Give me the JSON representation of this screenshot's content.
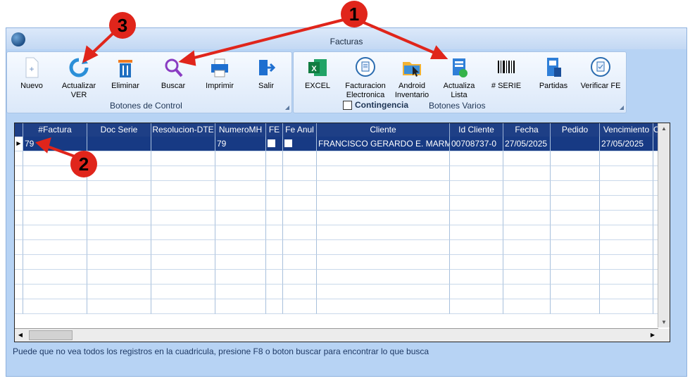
{
  "window": {
    "title": "Facturas"
  },
  "control_group": {
    "label": "Botones de Control",
    "buttons": [
      {
        "label": "Nuevo"
      },
      {
        "label": "Actualizar VER"
      },
      {
        "label": "Eliminar"
      },
      {
        "label": "Buscar"
      },
      {
        "label": "Imprimir"
      },
      {
        "label": "Salir"
      }
    ]
  },
  "varios_group": {
    "label": "Botones Varios",
    "contingencia_label": "Contingencia",
    "buttons": [
      {
        "label": "EXCEL"
      },
      {
        "label": "Facturacion Electronica"
      },
      {
        "label": "Android Inventario"
      },
      {
        "label": "Actualiza Lista"
      },
      {
        "label": "# SERIE"
      },
      {
        "label": "Partidas"
      },
      {
        "label": "Verificar FE"
      }
    ]
  },
  "grid": {
    "columns": [
      "#Factura",
      "Doc Serie",
      "Resolucion-DTE",
      "NumeroMH",
      "FE",
      "Fe Anul",
      "Cliente",
      "Id Cliente",
      "Fecha",
      "Pedido",
      "Vencimiento",
      "O"
    ],
    "rows": [
      [
        "79",
        "",
        "",
        "79",
        "",
        "",
        "FRANCISCO GERARDO E. MARM",
        "00708737-0",
        "27/05/2025",
        "",
        "27/05/2025",
        ""
      ]
    ]
  },
  "footer": {
    "message": "Puede que no vea todos los registros en la cuadricula, presione F8 o boton buscar para encontrar lo que busca"
  },
  "callouts": {
    "one": "1",
    "two": "2",
    "three": "3"
  },
  "colors": {
    "header": "#1e3f86",
    "selected_row": "#173a84",
    "callout": "#e0251b",
    "window_bg": "#b7d3f4"
  }
}
